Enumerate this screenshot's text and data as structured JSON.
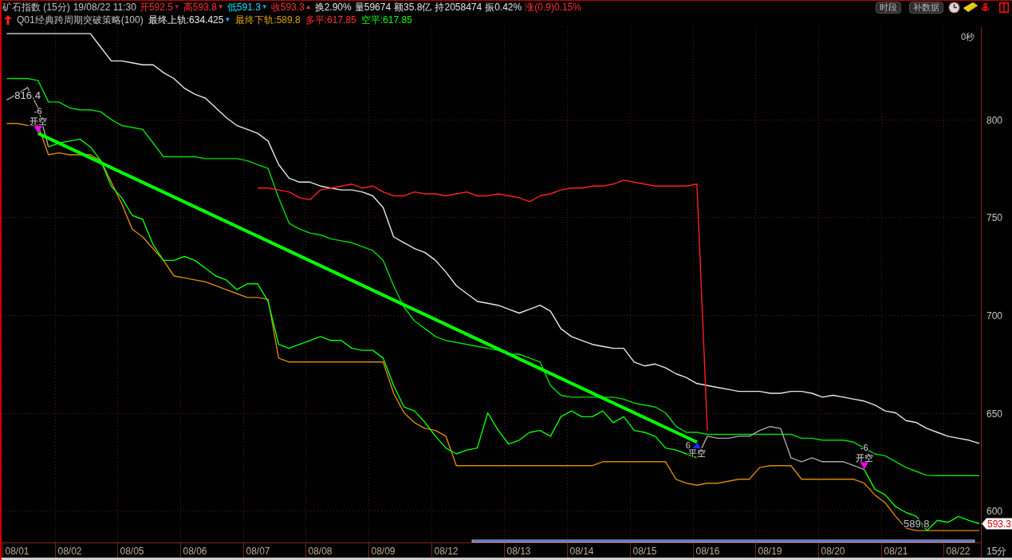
{
  "header": {
    "title": "矿石指数 (15分)",
    "datetime": "19/08/22 11:30",
    "quotes": [
      {
        "text": "开592.5",
        "color": "#ff3030",
        "mark": {
          "text": "▼",
          "color": "#c02020"
        }
      },
      {
        "text": "高593.8",
        "color": "#ff3030",
        "mark": {
          "text": "▼",
          "color": "#ff3030"
        }
      },
      {
        "text": "低591.3",
        "color": "#00e0ff",
        "mark": {
          "text": "▼",
          "color": "#00b0ff"
        }
      },
      {
        "text": "收593.3",
        "color": "#ff3030",
        "mark": {
          "text": "▲",
          "color": "#ff3030"
        }
      },
      {
        "text": "换2.90%",
        "color": "#e4e4e4"
      },
      {
        "text": "量59674",
        "color": "#e4e4e4"
      },
      {
        "text": "额35.8亿",
        "color": "#e4e4e4"
      },
      {
        "text": "持2058474",
        "color": "#e4e4e4"
      },
      {
        "text": "振0.42%",
        "color": "#e4e4e4"
      },
      {
        "text": "涨(0.9)0.15%",
        "color": "#ff3030"
      }
    ],
    "buttons": [
      "时段",
      "补数据"
    ]
  },
  "indicator": {
    "name": "Q01经典跨周期突破策略(100)",
    "values": [
      {
        "text": "最终上轨:634.425",
        "color": "#ececec",
        "mark": {
          "text": "▼",
          "color": "#20b0ff"
        }
      },
      {
        "text": "最终下轨:589.8",
        "color": "#e0a000"
      },
      {
        "text": "多平:617.85",
        "color": "#ff3030"
      },
      {
        "text": "空平:617.85",
        "color": "#00ff00"
      }
    ]
  },
  "chart": {
    "countdown": "0秒",
    "last_price": "593.3",
    "period_label": "15分",
    "chart_data": {
      "type": "line",
      "grid": true,
      "categories": [
        null,
        "08/01",
        null,
        null,
        null,
        null,
        "08/02",
        null,
        null,
        null,
        null,
        null,
        "08/05",
        null,
        null,
        null,
        null,
        null,
        "08/06",
        null,
        null,
        null,
        null,
        null,
        "08/07",
        null,
        null,
        null,
        null,
        null,
        "08/08",
        null,
        null,
        null,
        null,
        null,
        "08/09",
        null,
        null,
        null,
        null,
        null,
        "08/12",
        null,
        null,
        null,
        null,
        null,
        null,
        "08/13",
        null,
        null,
        null,
        null,
        null,
        "08/14",
        null,
        null,
        null,
        null,
        null,
        "08/15",
        null,
        null,
        null,
        null,
        null,
        "08/16",
        null,
        null,
        null,
        null,
        null,
        "08/19",
        null,
        null,
        null,
        null,
        null,
        "08/20",
        null,
        null,
        null,
        null,
        null,
        "08/21",
        null,
        null,
        null,
        null,
        null,
        "08/22",
        null,
        null
      ],
      "ylim": [
        583.7,
        847.3
      ],
      "yticks": [
        600,
        650,
        700,
        750,
        800
      ],
      "series": [
        {
          "color": "#e8e8e8",
          "values": [
            844,
            844,
            844,
            844,
            844,
            844,
            844,
            844,
            844,
            837,
            830,
            830,
            829,
            828,
            828,
            824,
            821,
            816,
            813,
            811,
            806,
            801,
            797,
            795,
            793,
            789,
            777,
            770,
            768,
            768,
            766,
            765,
            764,
            764,
            763,
            761,
            755,
            740,
            737,
            734,
            732,
            728,
            722,
            715,
            711,
            707,
            706,
            705,
            703,
            701,
            703,
            705,
            702,
            693,
            689,
            687,
            685,
            684,
            683,
            683,
            676,
            674,
            675,
            673,
            670,
            668,
            665,
            664,
            663,
            662,
            661,
            661,
            661,
            660,
            660,
            661,
            661,
            660,
            658,
            659,
            658,
            657,
            656,
            654,
            651,
            650,
            646,
            645,
            642,
            640,
            638,
            637,
            636,
            634.4
          ]
        },
        {
          "color": "#00dc00",
          "values": [
            821,
            821,
            821,
            820,
            809,
            809,
            806,
            805,
            805,
            804,
            800,
            797,
            796,
            795,
            788,
            781,
            781,
            781,
            781,
            780,
            780,
            780,
            780,
            779,
            777,
            775,
            760,
            747,
            744,
            742,
            741,
            739,
            738,
            737,
            735,
            733,
            728,
            715,
            704,
            697,
            693,
            689,
            687,
            686,
            685,
            684,
            683,
            682,
            680,
            680,
            678,
            676,
            664,
            659,
            658,
            658,
            658,
            658,
            658,
            657,
            655,
            654,
            653,
            650,
            643,
            640,
            640,
            639,
            639,
            639,
            639,
            639,
            639,
            639,
            639,
            639,
            637,
            637,
            636,
            636,
            636,
            635,
            632,
            629,
            628,
            625,
            622,
            620,
            618,
            617.9,
            617.9,
            617.9,
            617.9,
            617.9
          ]
        },
        {
          "color": "#d88a00",
          "values": [
            798,
            798,
            797,
            797,
            782,
            783,
            782,
            782,
            782,
            779,
            768,
            757,
            744,
            740,
            734,
            728,
            720,
            719,
            718,
            717,
            715,
            713,
            711,
            709,
            709,
            708,
            678,
            676,
            676,
            676,
            676,
            676,
            676,
            676,
            676,
            676,
            676,
            660,
            650,
            645,
            642,
            641,
            638,
            623,
            623,
            623,
            623,
            623,
            623,
            623,
            623,
            623,
            623,
            623,
            623,
            623,
            623,
            625,
            625,
            625,
            625,
            625,
            625,
            625,
            616,
            614,
            613,
            614,
            614,
            615,
            616,
            616,
            622,
            623,
            623,
            623,
            616,
            616,
            616,
            616,
            616,
            616,
            614,
            608,
            604,
            597,
            591,
            589.8,
            589.8,
            589.8,
            589.8,
            589.8,
            589.8,
            589.8
          ]
        },
        {
          "color": "#ff2020",
          "values": [
            null,
            null,
            null,
            null,
            null,
            null,
            null,
            null,
            null,
            null,
            null,
            null,
            null,
            null,
            null,
            null,
            null,
            null,
            null,
            null,
            null,
            null,
            null,
            null,
            765,
            765,
            764,
            763,
            760,
            759,
            764,
            765,
            766,
            767,
            765,
            766,
            763,
            761,
            761,
            763,
            762,
            762,
            761,
            762,
            763,
            761,
            761,
            762,
            761,
            760,
            758,
            761,
            762,
            764,
            765,
            765,
            766,
            766,
            767,
            769,
            768,
            767,
            766,
            766,
            766,
            766,
            767,
            641,
            null,
            null,
            null,
            null,
            null,
            null,
            null,
            null,
            null,
            null,
            null,
            null,
            null,
            null,
            null,
            null,
            null,
            null,
            null,
            null,
            null,
            null,
            null,
            null,
            null,
            null
          ]
        },
        {
          "color": "#a8a8a8",
          "values": [
            810,
            813,
            816.4,
            806,
            786,
            null,
            null,
            null,
            null,
            null,
            null,
            null,
            null,
            null,
            null,
            null,
            null,
            null,
            null,
            null,
            null,
            null,
            null,
            null,
            null,
            null,
            null,
            null,
            null,
            null,
            null,
            null,
            null,
            null,
            null,
            null,
            null,
            null,
            null,
            null,
            null,
            null,
            null,
            null,
            null,
            null,
            null,
            null,
            null,
            null,
            null,
            null,
            null,
            null,
            null,
            null,
            null,
            null,
            null,
            null,
            null,
            null,
            null,
            null,
            null,
            null,
            null,
            null,
            null,
            null,
            null,
            null,
            null,
            null,
            null,
            null,
            null,
            null,
            null,
            null,
            null,
            null,
            null,
            null,
            null,
            null,
            null,
            null,
            null,
            null,
            null,
            null,
            null,
            null
          ]
        },
        {
          "color": "#a8a8a8",
          "values": [
            null,
            null,
            null,
            null,
            null,
            null,
            null,
            null,
            null,
            null,
            null,
            null,
            null,
            null,
            null,
            null,
            null,
            null,
            null,
            null,
            null,
            null,
            null,
            null,
            null,
            null,
            null,
            null,
            null,
            null,
            null,
            null,
            null,
            null,
            null,
            null,
            null,
            null,
            null,
            null,
            null,
            null,
            null,
            null,
            null,
            null,
            null,
            null,
            null,
            null,
            null,
            null,
            null,
            null,
            null,
            null,
            null,
            null,
            null,
            null,
            null,
            null,
            null,
            null,
            null,
            null,
            627,
            638,
            637,
            637,
            638,
            638,
            641,
            643,
            642,
            627,
            625,
            627,
            625,
            625,
            625,
            623,
            621,
            null,
            null,
            null,
            null,
            null,
            null,
            null,
            null,
            null,
            null,
            null
          ]
        },
        {
          "color": "#00ff00",
          "values": [
            null,
            null,
            null,
            null,
            786,
            788,
            789,
            790,
            786,
            779,
            766,
            760,
            751,
            749,
            736,
            728,
            728,
            730,
            728,
            724,
            720,
            718,
            713,
            716,
            716,
            707,
            685,
            683,
            685,
            687,
            689,
            687,
            687,
            683,
            682,
            682,
            678,
            664,
            653,
            651,
            645,
            638,
            632,
            629,
            631,
            632,
            650,
            641,
            634,
            636,
            640,
            641,
            638,
            648,
            651,
            648,
            648,
            651,
            645,
            648,
            641,
            640,
            638,
            632,
            631,
            629,
            627,
            null,
            null,
            null,
            null,
            null,
            null,
            null,
            null,
            null,
            null,
            null,
            null,
            null,
            null,
            null,
            null,
            null,
            null,
            null,
            null,
            null,
            null,
            null,
            null,
            null,
            null,
            null
          ]
        },
        {
          "color": "#00ff00",
          "values": [
            null,
            null,
            null,
            null,
            null,
            null,
            null,
            null,
            null,
            null,
            null,
            null,
            null,
            null,
            null,
            null,
            null,
            null,
            null,
            null,
            null,
            null,
            null,
            null,
            null,
            null,
            null,
            null,
            null,
            null,
            null,
            null,
            null,
            null,
            null,
            null,
            null,
            null,
            null,
            null,
            null,
            null,
            null,
            null,
            null,
            null,
            null,
            null,
            null,
            null,
            null,
            null,
            null,
            null,
            null,
            null,
            null,
            null,
            null,
            null,
            null,
            null,
            null,
            null,
            null,
            null,
            null,
            null,
            null,
            null,
            null,
            null,
            null,
            null,
            null,
            null,
            null,
            null,
            null,
            null,
            null,
            null,
            621,
            611,
            608,
            602,
            599,
            597,
            589.8,
            595,
            594,
            597,
            595,
            593.3
          ]
        },
        {
          "color": "#00ff00",
          "values": [
            null,
            null,
            null,
            793,
            null,
            null,
            null,
            null,
            null,
            null,
            null,
            null,
            null,
            null,
            null,
            null,
            null,
            null,
            null,
            null,
            null,
            null,
            null,
            null,
            null,
            null,
            null,
            null,
            null,
            null,
            null,
            null,
            null,
            null,
            null,
            null,
            null,
            null,
            null,
            null,
            null,
            null,
            null,
            null,
            null,
            null,
            null,
            null,
            null,
            null,
            null,
            null,
            null,
            null,
            null,
            null,
            null,
            null,
            null,
            null,
            null,
            null,
            null,
            null,
            null,
            null,
            635,
            null,
            null,
            null,
            null,
            null,
            null,
            null,
            null,
            null,
            null,
            null,
            null,
            null,
            null,
            null,
            null,
            null,
            null,
            null,
            null,
            null,
            null,
            null,
            null,
            null,
            null,
            null
          ]
        }
      ],
      "annotations": [
        {
          "text": "816.4",
          "y": 816.4
        },
        {
          "text": "-6",
          "y": 793
        },
        {
          "text": "开空",
          "y": 793
        },
        {
          "text": "平空",
          "y": 635
        },
        {
          "text": "6",
          "y": 635
        },
        {
          "text": "-6",
          "y": 621
        },
        {
          "text": "开空",
          "y": 621
        },
        {
          "text": "589.8",
          "y": 589.8
        }
      ]
    }
  }
}
